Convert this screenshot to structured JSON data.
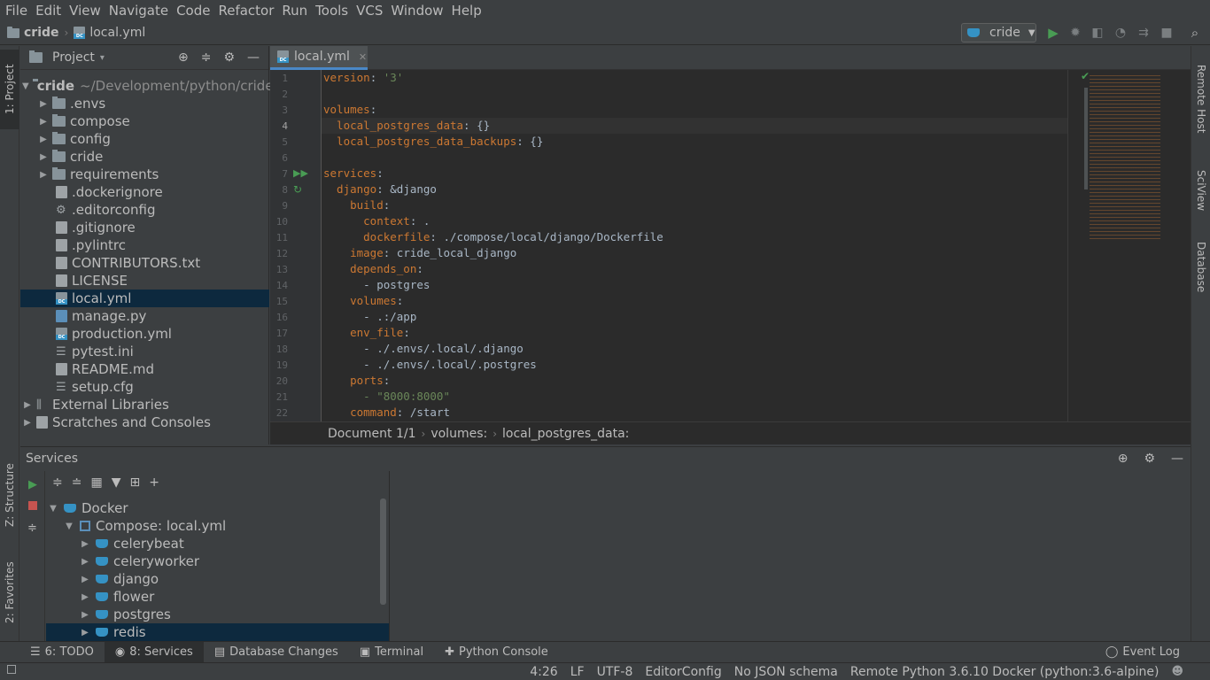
{
  "menu": [
    "File",
    "Edit",
    "View",
    "Navigate",
    "Code",
    "Refactor",
    "Run",
    "Tools",
    "VCS",
    "Window",
    "Help"
  ],
  "navbar": {
    "project": "cride",
    "file": "local.yml"
  },
  "run_config": "cride",
  "left_stripe": {
    "project": "1: Project",
    "structure": "Z: Structure",
    "favorites": "2: Favorites"
  },
  "right_stripe": {
    "remote_host": "Remote Host",
    "sciview": "SciView",
    "database": "Database"
  },
  "project_panel": {
    "title": "Project",
    "root": {
      "name": "cride",
      "path": "~/Development/python/cride"
    },
    "folders": [
      ".envs",
      "compose",
      "config",
      "cride",
      "requirements"
    ],
    "files": [
      ".dockerignore",
      ".editorconfig",
      ".gitignore",
      ".pylintrc",
      "CONTRIBUTORS.txt",
      "LICENSE",
      "local.yml",
      "manage.py",
      "production.yml",
      "pytest.ini",
      "README.md",
      "setup.cfg"
    ],
    "external": "External Libraries",
    "scratches": "Scratches and Consoles"
  },
  "editor": {
    "tab": "local.yml",
    "line_numbers": [
      "1",
      "2",
      "3",
      "4",
      "5",
      "6",
      "7",
      "8",
      "9",
      "10",
      "11",
      "12",
      "13",
      "14",
      "15",
      "16",
      "17",
      "18",
      "19",
      "20",
      "21",
      "22"
    ],
    "lines": [
      {
        "k": "version",
        "v": " '3'"
      },
      {
        "k": "",
        "v": ""
      },
      {
        "k": "volumes",
        "v": ""
      },
      {
        "k": "  local_postgres_data",
        "v": " {}"
      },
      {
        "k": "  local_postgres_data_backups",
        "v": " {}"
      },
      {
        "k": "",
        "v": ""
      },
      {
        "k": "services",
        "v": ""
      },
      {
        "k": "  django",
        "v": " &django"
      },
      {
        "k": "    build",
        "v": ""
      },
      {
        "k": "      context",
        "v": " ."
      },
      {
        "k": "      dockerfile",
        "v": " ./compose/local/django/Dockerfile"
      },
      {
        "k": "    image",
        "v": " cride_local_django"
      },
      {
        "k": "    depends_on",
        "v": ""
      },
      {
        "k": "",
        "v": "      - postgres"
      },
      {
        "k": "    volumes",
        "v": ""
      },
      {
        "k": "",
        "v": "      - .:/app"
      },
      {
        "k": "    env_file",
        "v": ""
      },
      {
        "k": "",
        "v": "      - ./.envs/.local/.django"
      },
      {
        "k": "",
        "v": "      - ./.envs/.local/.postgres"
      },
      {
        "k": "    ports",
        "v": ""
      },
      {
        "k": "",
        "v": "      - \"8000:8000\""
      },
      {
        "k": "    command",
        "v": " /start"
      }
    ],
    "breadcrumbs": [
      "Document 1/1",
      "volumes:",
      "local_postgres_data:"
    ]
  },
  "services_panel": {
    "title": "Services",
    "docker": "Docker",
    "compose": "Compose: local.yml",
    "services": [
      "celerybeat",
      "celeryworker",
      "django",
      "flower",
      "postgres",
      "redis"
    ]
  },
  "bottom_tabs": [
    "6: TODO",
    "8: Services",
    "Database Changes",
    "Terminal",
    "Python Console"
  ],
  "event_log": "Event Log",
  "status": [
    "4:26",
    "LF",
    "UTF-8",
    "EditorConfig",
    "No JSON schema",
    "Remote Python 3.6.10 Docker (python:3.6-alpine)"
  ]
}
